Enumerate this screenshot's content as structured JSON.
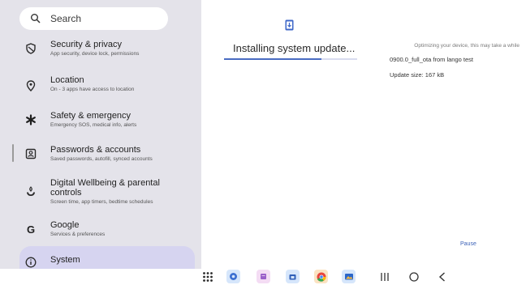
{
  "search": {
    "label": "Search"
  },
  "settings_items": [
    {
      "title": "Security & privacy",
      "subtitle": "App security, device lock, permissions",
      "icon": "shield-icon"
    },
    {
      "title": "Location",
      "subtitle": "On - 3 apps have access to location",
      "icon": "location-pin-icon"
    },
    {
      "title": "Safety & emergency",
      "subtitle": "Emergency SOS, medical info, alerts",
      "icon": "asterisk-icon"
    },
    {
      "title": "Passwords & accounts",
      "subtitle": "Saved passwords, autofill, synced accounts",
      "icon": "account-box-icon"
    },
    {
      "title_line1": "Digital Wellbeing & parental",
      "title_line2": "controls",
      "subtitle": "Screen time, app timers, bedtime schedules",
      "icon": "wellbeing-icon"
    },
    {
      "title": "Google",
      "subtitle": "Services & preferences",
      "icon": "google-icon"
    },
    {
      "title": "System",
      "icon": "info-icon",
      "selected": true
    }
  ],
  "update": {
    "title": "Installing system update...",
    "optimizing_text": "Optimizing your device, this may take a while",
    "ota_name": "0900.0_full_ota from lango test",
    "size_text": "Update size: 167 kB",
    "progress": 0.73,
    "pause_label": "Pause"
  },
  "navbar": {
    "dock_apps": [
      "settings-app-icon",
      "notes-app-icon",
      "store-app-icon",
      "chrome-app-icon",
      "photos-app-icon"
    ]
  },
  "colors": {
    "sidebar_bg": "#e4e3ea",
    "selected_bg": "#d6d4f0",
    "accent": "#4a6cc2",
    "pause_color": "#3d63b8"
  }
}
